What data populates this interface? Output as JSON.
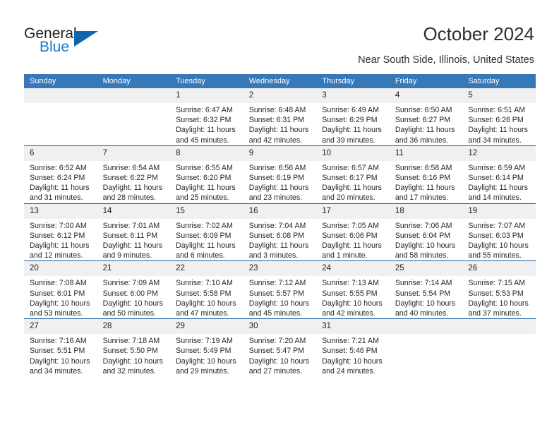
{
  "brand": {
    "name_top": "General",
    "name_bottom": "Blue",
    "color_dark": "#231f20",
    "color_blue": "#1f7ac6",
    "triangle_color": "#1066ac"
  },
  "header": {
    "title": "October 2024",
    "subtitle": "Near South Side, Illinois, United States"
  },
  "theme": {
    "header_blue": "#3778b8",
    "row_rule_blue": "#1f5f9e",
    "daynum_band": "#f0f0f0",
    "text": "#262626"
  },
  "calendar": {
    "weekday_headers": [
      "Sunday",
      "Monday",
      "Tuesday",
      "Wednesday",
      "Thursday",
      "Friday",
      "Saturday"
    ],
    "weeks": [
      [
        {
          "day": "",
          "lines": []
        },
        {
          "day": "",
          "lines": []
        },
        {
          "day": "1",
          "lines": [
            "Sunrise: 6:47 AM",
            "Sunset: 6:32 PM",
            "Daylight: 11 hours",
            "and 45 minutes."
          ]
        },
        {
          "day": "2",
          "lines": [
            "Sunrise: 6:48 AM",
            "Sunset: 6:31 PM",
            "Daylight: 11 hours",
            "and 42 minutes."
          ]
        },
        {
          "day": "3",
          "lines": [
            "Sunrise: 6:49 AM",
            "Sunset: 6:29 PM",
            "Daylight: 11 hours",
            "and 39 minutes."
          ]
        },
        {
          "day": "4",
          "lines": [
            "Sunrise: 6:50 AM",
            "Sunset: 6:27 PM",
            "Daylight: 11 hours",
            "and 36 minutes."
          ]
        },
        {
          "day": "5",
          "lines": [
            "Sunrise: 6:51 AM",
            "Sunset: 6:26 PM",
            "Daylight: 11 hours",
            "and 34 minutes."
          ]
        }
      ],
      [
        {
          "day": "6",
          "lines": [
            "Sunrise: 6:52 AM",
            "Sunset: 6:24 PM",
            "Daylight: 11 hours",
            "and 31 minutes."
          ]
        },
        {
          "day": "7",
          "lines": [
            "Sunrise: 6:54 AM",
            "Sunset: 6:22 PM",
            "Daylight: 11 hours",
            "and 28 minutes."
          ]
        },
        {
          "day": "8",
          "lines": [
            "Sunrise: 6:55 AM",
            "Sunset: 6:20 PM",
            "Daylight: 11 hours",
            "and 25 minutes."
          ]
        },
        {
          "day": "9",
          "lines": [
            "Sunrise: 6:56 AM",
            "Sunset: 6:19 PM",
            "Daylight: 11 hours",
            "and 23 minutes."
          ]
        },
        {
          "day": "10",
          "lines": [
            "Sunrise: 6:57 AM",
            "Sunset: 6:17 PM",
            "Daylight: 11 hours",
            "and 20 minutes."
          ]
        },
        {
          "day": "11",
          "lines": [
            "Sunrise: 6:58 AM",
            "Sunset: 6:16 PM",
            "Daylight: 11 hours",
            "and 17 minutes."
          ]
        },
        {
          "day": "12",
          "lines": [
            "Sunrise: 6:59 AM",
            "Sunset: 6:14 PM",
            "Daylight: 11 hours",
            "and 14 minutes."
          ]
        }
      ],
      [
        {
          "day": "13",
          "lines": [
            "Sunrise: 7:00 AM",
            "Sunset: 6:12 PM",
            "Daylight: 11 hours",
            "and 12 minutes."
          ]
        },
        {
          "day": "14",
          "lines": [
            "Sunrise: 7:01 AM",
            "Sunset: 6:11 PM",
            "Daylight: 11 hours",
            "and 9 minutes."
          ]
        },
        {
          "day": "15",
          "lines": [
            "Sunrise: 7:02 AM",
            "Sunset: 6:09 PM",
            "Daylight: 11 hours",
            "and 6 minutes."
          ]
        },
        {
          "day": "16",
          "lines": [
            "Sunrise: 7:04 AM",
            "Sunset: 6:08 PM",
            "Daylight: 11 hours",
            "and 3 minutes."
          ]
        },
        {
          "day": "17",
          "lines": [
            "Sunrise: 7:05 AM",
            "Sunset: 6:06 PM",
            "Daylight: 11 hours",
            "and 1 minute."
          ]
        },
        {
          "day": "18",
          "lines": [
            "Sunrise: 7:06 AM",
            "Sunset: 6:04 PM",
            "Daylight: 10 hours",
            "and 58 minutes."
          ]
        },
        {
          "day": "19",
          "lines": [
            "Sunrise: 7:07 AM",
            "Sunset: 6:03 PM",
            "Daylight: 10 hours",
            "and 55 minutes."
          ]
        }
      ],
      [
        {
          "day": "20",
          "lines": [
            "Sunrise: 7:08 AM",
            "Sunset: 6:01 PM",
            "Daylight: 10 hours",
            "and 53 minutes."
          ]
        },
        {
          "day": "21",
          "lines": [
            "Sunrise: 7:09 AM",
            "Sunset: 6:00 PM",
            "Daylight: 10 hours",
            "and 50 minutes."
          ]
        },
        {
          "day": "22",
          "lines": [
            "Sunrise: 7:10 AM",
            "Sunset: 5:58 PM",
            "Daylight: 10 hours",
            "and 47 minutes."
          ]
        },
        {
          "day": "23",
          "lines": [
            "Sunrise: 7:12 AM",
            "Sunset: 5:57 PM",
            "Daylight: 10 hours",
            "and 45 minutes."
          ]
        },
        {
          "day": "24",
          "lines": [
            "Sunrise: 7:13 AM",
            "Sunset: 5:55 PM",
            "Daylight: 10 hours",
            "and 42 minutes."
          ]
        },
        {
          "day": "25",
          "lines": [
            "Sunrise: 7:14 AM",
            "Sunset: 5:54 PM",
            "Daylight: 10 hours",
            "and 40 minutes."
          ]
        },
        {
          "day": "26",
          "lines": [
            "Sunrise: 7:15 AM",
            "Sunset: 5:53 PM",
            "Daylight: 10 hours",
            "and 37 minutes."
          ]
        }
      ],
      [
        {
          "day": "27",
          "lines": [
            "Sunrise: 7:16 AM",
            "Sunset: 5:51 PM",
            "Daylight: 10 hours",
            "and 34 minutes."
          ]
        },
        {
          "day": "28",
          "lines": [
            "Sunrise: 7:18 AM",
            "Sunset: 5:50 PM",
            "Daylight: 10 hours",
            "and 32 minutes."
          ]
        },
        {
          "day": "29",
          "lines": [
            "Sunrise: 7:19 AM",
            "Sunset: 5:49 PM",
            "Daylight: 10 hours",
            "and 29 minutes."
          ]
        },
        {
          "day": "30",
          "lines": [
            "Sunrise: 7:20 AM",
            "Sunset: 5:47 PM",
            "Daylight: 10 hours",
            "and 27 minutes."
          ]
        },
        {
          "day": "31",
          "lines": [
            "Sunrise: 7:21 AM",
            "Sunset: 5:46 PM",
            "Daylight: 10 hours",
            "and 24 minutes."
          ]
        },
        {
          "day": "",
          "lines": []
        },
        {
          "day": "",
          "lines": []
        }
      ]
    ]
  }
}
